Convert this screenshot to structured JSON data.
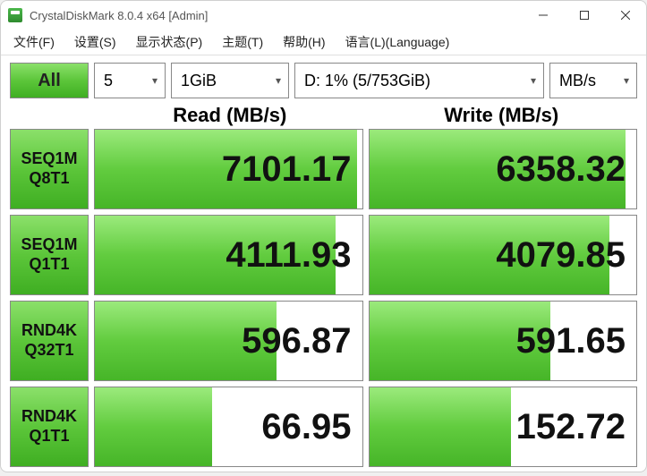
{
  "window": {
    "title": "CrystalDiskMark 8.0.4 x64 [Admin]"
  },
  "menu": {
    "file": "文件(F)",
    "settings": "设置(S)",
    "display": "显示状态(P)",
    "theme": "主题(T)",
    "help": "帮助(H)",
    "language": "语言(L)(Language)"
  },
  "controls": {
    "all_label": "All",
    "runs": "5",
    "size": "1GiB",
    "drive": "D: 1% (5/753GiB)",
    "unit": "MB/s"
  },
  "headers": {
    "read": "Read (MB/s)",
    "write": "Write (MB/s)"
  },
  "tests": [
    {
      "label1": "SEQ1M",
      "label2": "Q8T1",
      "read": "7101.17",
      "write": "6358.32",
      "read_fill": 98,
      "write_fill": 96
    },
    {
      "label1": "SEQ1M",
      "label2": "Q1T1",
      "read": "4111.93",
      "write": "4079.85",
      "read_fill": 90,
      "write_fill": 90
    },
    {
      "label1": "RND4K",
      "label2": "Q32T1",
      "read": "596.87",
      "write": "591.65",
      "read_fill": 68,
      "write_fill": 68
    },
    {
      "label1": "RND4K",
      "label2": "Q1T1",
      "read": "66.95",
      "write": "152.72",
      "read_fill": 44,
      "write_fill": 53
    }
  ]
}
